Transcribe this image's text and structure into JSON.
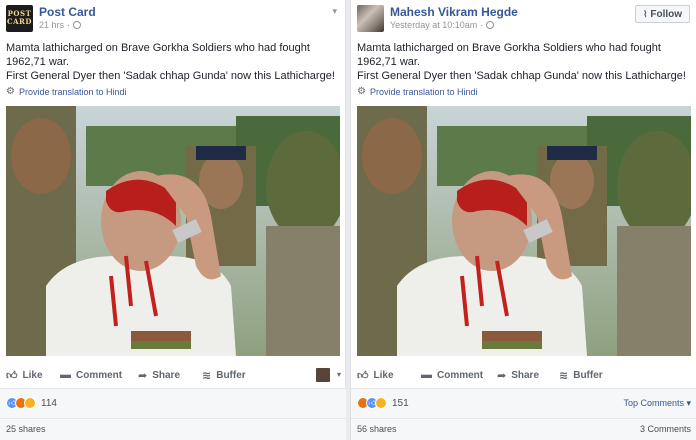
{
  "posts": [
    {
      "author": "Post Card",
      "avatar_text": [
        "POST",
        "CARD"
      ],
      "time": "21 hrs",
      "privacy_sep": "·",
      "text_line1": "Mamta lathicharged on Brave Gorkha Soldiers who had fought 1962,71 war.",
      "text_line2": "First General Dyer then 'Sadak chhap Gunda' now this Lathicharge!",
      "translate": "Provide translation to Hindi",
      "actions": {
        "like": "Like",
        "comment": "Comment",
        "share": "Share",
        "buffer": "Buffer"
      },
      "reaction_count": "114",
      "reactions": [
        "like",
        "angry",
        "sad"
      ],
      "shares": "25 shares"
    },
    {
      "author": "Mahesh Vikram Hegde",
      "time": "Yesterday at 10:10am",
      "privacy_sep": "·",
      "follow_label": "Follow",
      "text_line1": "Mamta lathicharged on Brave Gorkha Soldiers who had fought 1962,71 war.",
      "text_line2": "First General Dyer then 'Sadak chhap Gunda' now this Lathicharge!",
      "translate": "Provide translation to Hindi",
      "actions": {
        "like": "Like",
        "comment": "Comment",
        "share": "Share",
        "buffer": "Buffer"
      },
      "reaction_count": "151",
      "reactions": [
        "angry",
        "like",
        "sad"
      ],
      "top_comments": "Top Comments",
      "shares": "56 shares",
      "comments": "3 Comments"
    }
  ],
  "icons": {
    "chevron": "chevron-down-icon",
    "globe": "globe-icon",
    "gear": "gear-icon",
    "like": "thumbs-up-icon",
    "comment": "speech-bubble-icon",
    "share": "share-arrow-icon",
    "buffer": "buffer-layers-icon",
    "rss": "rss-icon"
  },
  "colors": {
    "link": "#365899",
    "muted": "#90949c",
    "like": "#5890ff",
    "angry": "#e9710f",
    "sad": "#f7b125"
  }
}
